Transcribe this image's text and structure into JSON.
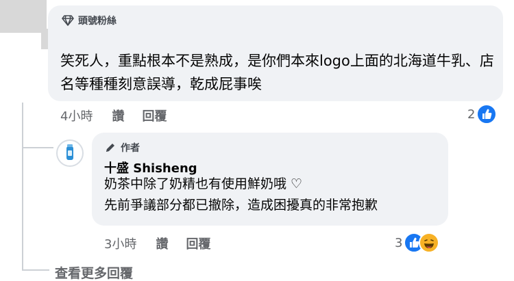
{
  "comment": {
    "badge": "頭號粉絲",
    "text": "笑死人，重點根本不是熟成，是你們本來logo上面的北海道牛乳、店名等種種刻意誤導，乾成屁事唉",
    "time": "4小時",
    "like_label": "讚",
    "reply_label": "回覆",
    "reaction_count": "2",
    "reaction_icons": [
      "like-icon"
    ]
  },
  "reply": {
    "badge": "作者",
    "author": "十盛 Shisheng",
    "line1": "奶茶中除了奶精也有使用鮮奶哦 ♡",
    "line2": "先前爭議部分都已撤除，造成困擾真的非常抱歉",
    "time": "3小時",
    "like_label": "讚",
    "reply_label": "回覆",
    "reaction_count": "3",
    "reaction_icons": [
      "like-icon",
      "haha-icon"
    ]
  },
  "view_more": "查看更多回覆",
  "colors": {
    "bubble": "#f0f2f5",
    "meta": "#65676b",
    "like": "#1877f2",
    "haha": "#f7b125"
  }
}
